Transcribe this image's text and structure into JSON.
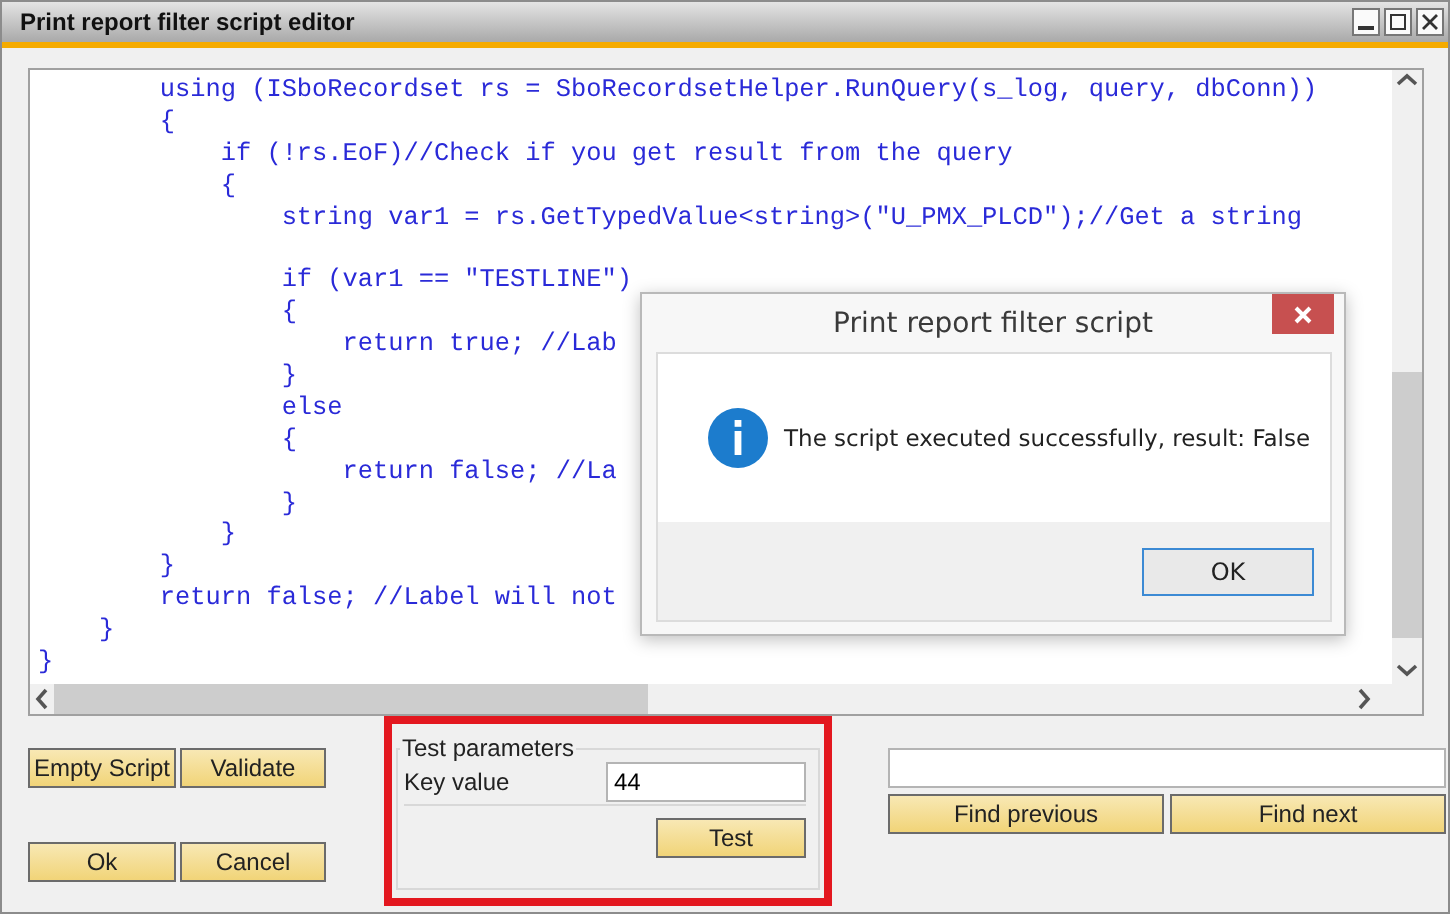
{
  "window": {
    "title": "Print report filter script editor"
  },
  "editor": {
    "lines": [
      {
        "text": "        using (ISboRecordset rs = SboRecordsetHelper.RunQuery(s_log, query, dbConn))"
      },
      {
        "text": "        {"
      },
      {
        "text": "            if (!rs.EoF)//Check if you get result from the query"
      },
      {
        "text": "            {"
      },
      {
        "text": "                string var1 = rs.GetTypedValue<string>(\"U_PMX_PLCD\");//Get a string"
      },
      {
        "kind": "blank"
      },
      {
        "text": "                if (var1 == \"TESTLINE\")"
      },
      {
        "text": "                {"
      },
      {
        "text": "                    return true; //Lab"
      },
      {
        "text": "                }"
      },
      {
        "text": "                else"
      },
      {
        "text": "                {"
      },
      {
        "text": "                    return false; //La"
      },
      {
        "text": "                }"
      },
      {
        "text": "            }"
      },
      {
        "text": "        }"
      },
      {
        "text": "        return false; //Label will not"
      },
      {
        "text": "    }"
      },
      {
        "text": "}"
      }
    ]
  },
  "script_buttons": [
    "Empty Script",
    "Validate"
  ],
  "form_buttons": [
    "Ok",
    "Cancel"
  ],
  "test_parameters": {
    "title": "Test parameters",
    "highlighted": true,
    "key_label": "Key value",
    "key_value": "44",
    "button": "Test"
  },
  "find": {
    "buttons": [
      "Find previous",
      "Find next"
    ]
  },
  "message_box": {
    "title": "Print report filter script",
    "message": "The script executed successfully, result: False",
    "buttons": [
      {
        "label": "OK",
        "focused": true
      }
    ]
  }
}
